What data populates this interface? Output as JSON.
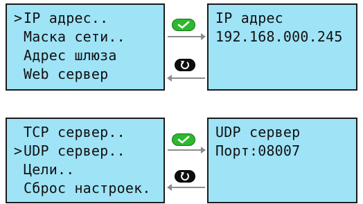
{
  "colors": {
    "lcd_background": "#9fe3f7",
    "lcd_border": "#1a1a1a",
    "ok_button": "#2db82d",
    "back_button": "#0d0d0d",
    "arrow": "#8c8c8c"
  },
  "panel1": {
    "menu": {
      "cursor": ">",
      "items": [
        {
          "label": "IP адрес..",
          "selected": true
        },
        {
          "label": "Маска сети..",
          "selected": false
        },
        {
          "label": "Адрес шлюза",
          "selected": false
        },
        {
          "label": "Web сервер",
          "selected": false
        }
      ]
    },
    "info": {
      "lines": [
        "IP адрес",
        "192.168.000.245"
      ]
    },
    "ok_icon": "check-icon",
    "back_icon": "return-icon"
  },
  "panel2": {
    "menu": {
      "cursor": ">",
      "items": [
        {
          "label": "TCP сервер..",
          "selected": false
        },
        {
          "label": "UDP сервер..",
          "selected": true
        },
        {
          "label": "Цели..",
          "selected": false
        },
        {
          "label": "Сброс настроек.",
          "selected": false
        }
      ]
    },
    "info": {
      "lines": [
        "UDP сервер",
        "Порт:08007"
      ]
    },
    "ok_icon": "check-icon",
    "back_icon": "return-icon"
  }
}
